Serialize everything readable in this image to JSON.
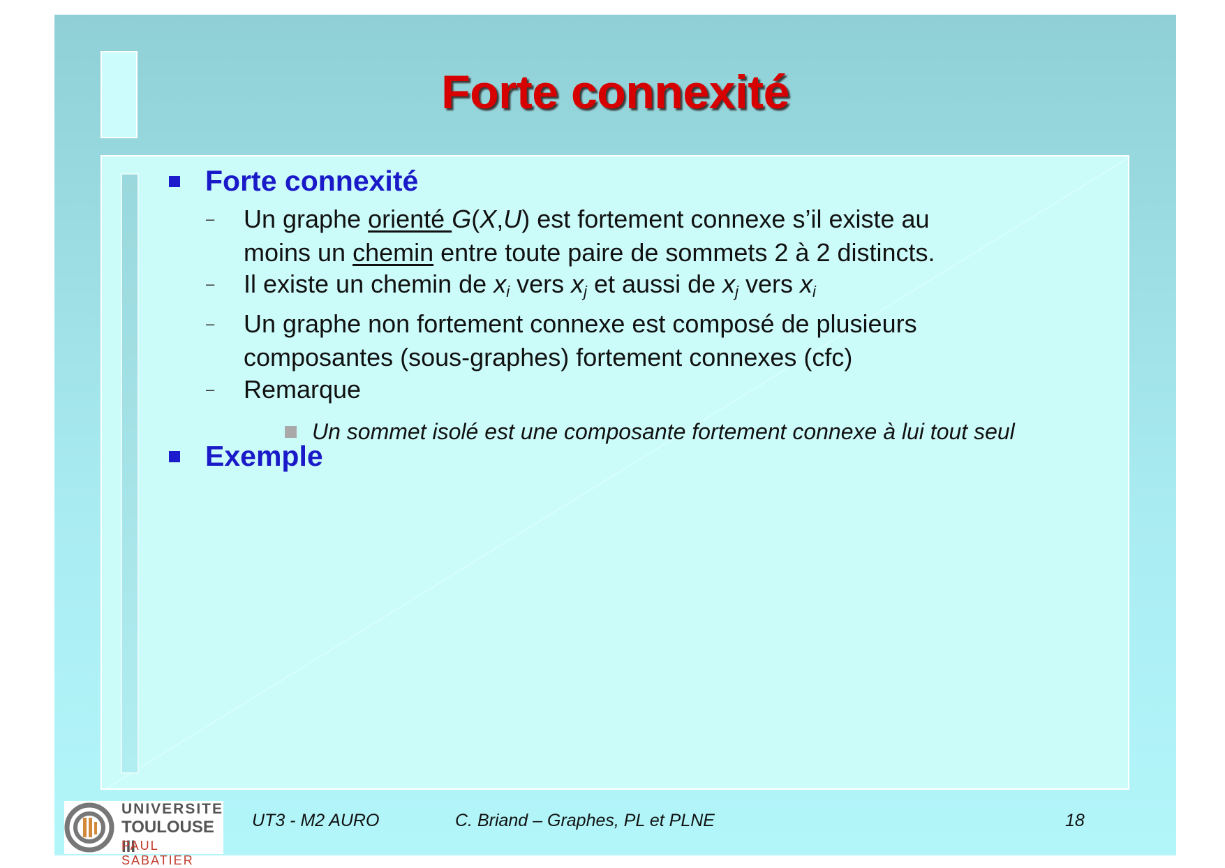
{
  "title": "Forte connexité",
  "section1": {
    "heading": "Forte connexité",
    "items": [
      {
        "p1": "Un graphe ",
        "u1": "orienté ",
        "g": "G",
        "p2": "(",
        "x": "X",
        "c": ",",
        "uu": "U",
        "p3": ") est fortement connexe s’il existe au",
        "line2a": "moins un ",
        "u2": "chemin",
        "line2b": " entre toute paire de sommets 2 à 2 distincts."
      },
      {
        "a": "Il existe un chemin de ",
        "x1": "x",
        "s1": "i",
        "b": " vers ",
        "x2": "x",
        "s2": "j",
        "c": " et aussi de ",
        "x3": "x",
        "s3": "j",
        "d": " vers ",
        "x4": "x",
        "s4": "i"
      },
      {
        "line1": "Un graphe non fortement connexe est composé de plusieurs",
        "line2": "composantes (sous-graphes) fortement connexes (cfc)"
      },
      {
        "text": "Remarque"
      }
    ],
    "subitem": "Un sommet isolé est une composante fortement connexe à lui tout seul"
  },
  "section2": {
    "heading": "Exemple"
  },
  "dash": "–",
  "footer": {
    "logo": {
      "line1": "UNIVERSITE",
      "line2": "TOULOUSE III",
      "line3": "PAUL SABATIER"
    },
    "course": "UT3 - M2 AURO",
    "author": "C. Briand – Graphes, PL et PLNE",
    "page": "18"
  }
}
